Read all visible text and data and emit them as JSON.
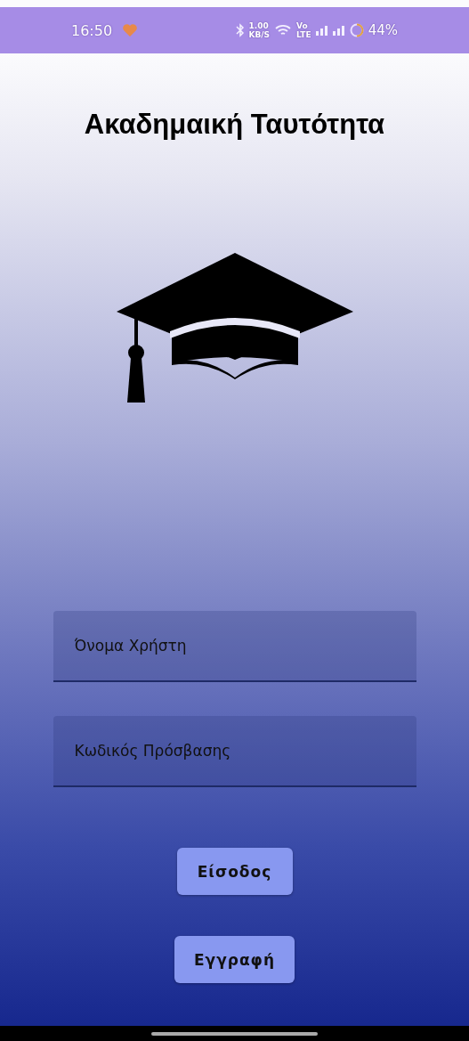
{
  "status_bar": {
    "time": "16:50",
    "speed_value": "1.00",
    "speed_unit": "KB/S",
    "volte_top": "Vo",
    "volte_bottom": "LTE",
    "battery": "44%"
  },
  "title": "Ακαδημαική Ταυτότητα",
  "fields": [
    {
      "placeholder": "Όνομα Χρήστη"
    },
    {
      "placeholder": "Κωδικός Πρόσβασης"
    }
  ],
  "buttons": [
    "Είσοδος",
    "Εγγραφή"
  ]
}
